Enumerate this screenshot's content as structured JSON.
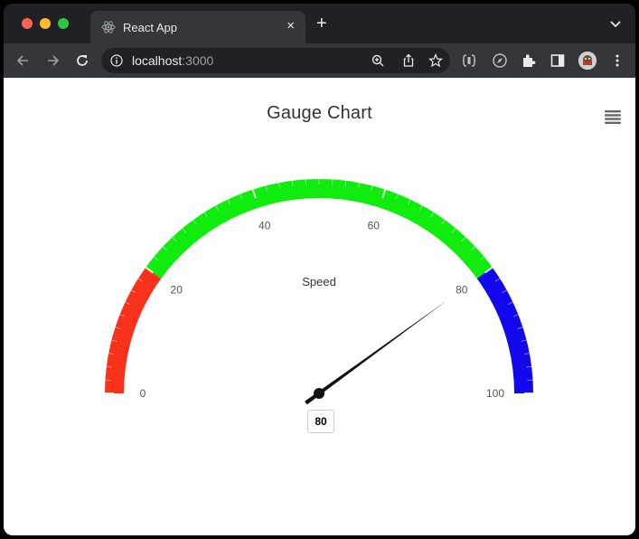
{
  "browser": {
    "tab_title": "React App",
    "tab_close": "×",
    "new_tab": "+",
    "url_host": "localhost",
    "url_port": ":3000"
  },
  "page": {
    "menu_icon": "hamburger-menu-icon"
  },
  "chart_data": {
    "type": "gauge",
    "title": "Gauge Chart",
    "min": 0,
    "max": 100,
    "value": 80,
    "value_label": "80",
    "pane_label": "Speed",
    "tick_labels": [
      "0",
      "20",
      "40",
      "60",
      "80",
      "100"
    ],
    "bands": [
      {
        "from": 0,
        "to": 20,
        "color": "#f7311a"
      },
      {
        "from": 20,
        "to": 80,
        "color": "#11ec0f"
      },
      {
        "from": 80,
        "to": 100,
        "color": "#1109ec"
      }
    ]
  }
}
